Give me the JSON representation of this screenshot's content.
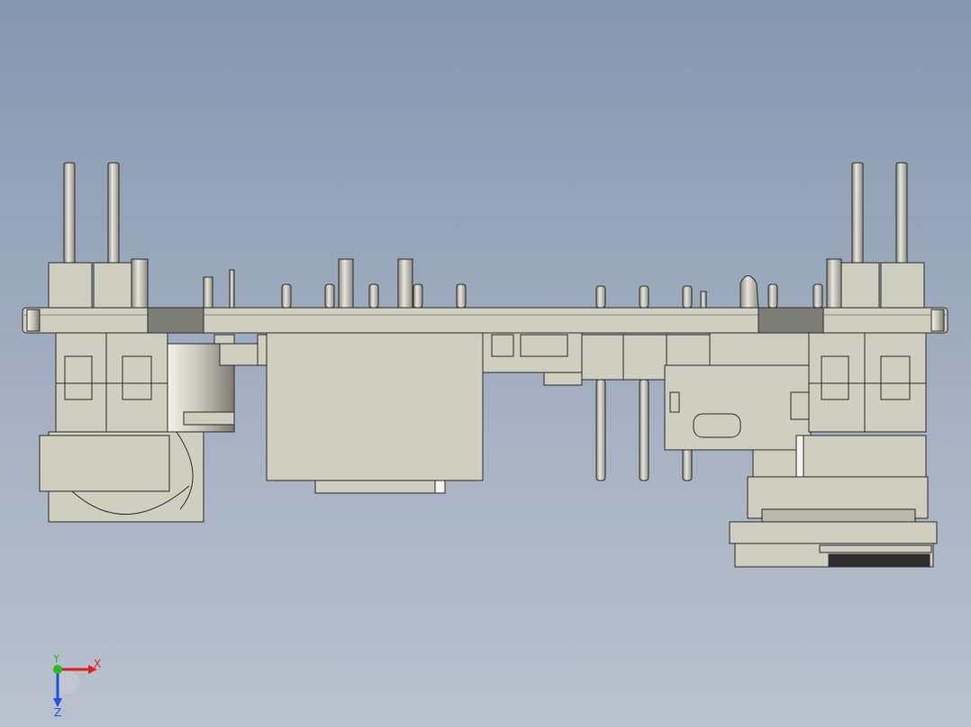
{
  "colors": {
    "background_top": "#8597ae",
    "background_bottom": "#b9c1ce",
    "part_fill": "#cfcfc0",
    "part_fill_dark": "#b9b9a8",
    "outline": "#2b2b2b",
    "dark_band": "#7e7e78",
    "axis_x": "#e02020",
    "axis_y": "#20c020",
    "axis_z": "#2050e0"
  },
  "triad": {
    "x_label": "X",
    "y_label": "Y",
    "z_label": "Z"
  },
  "model": {
    "description_name": "cad-assembly-side-view"
  }
}
